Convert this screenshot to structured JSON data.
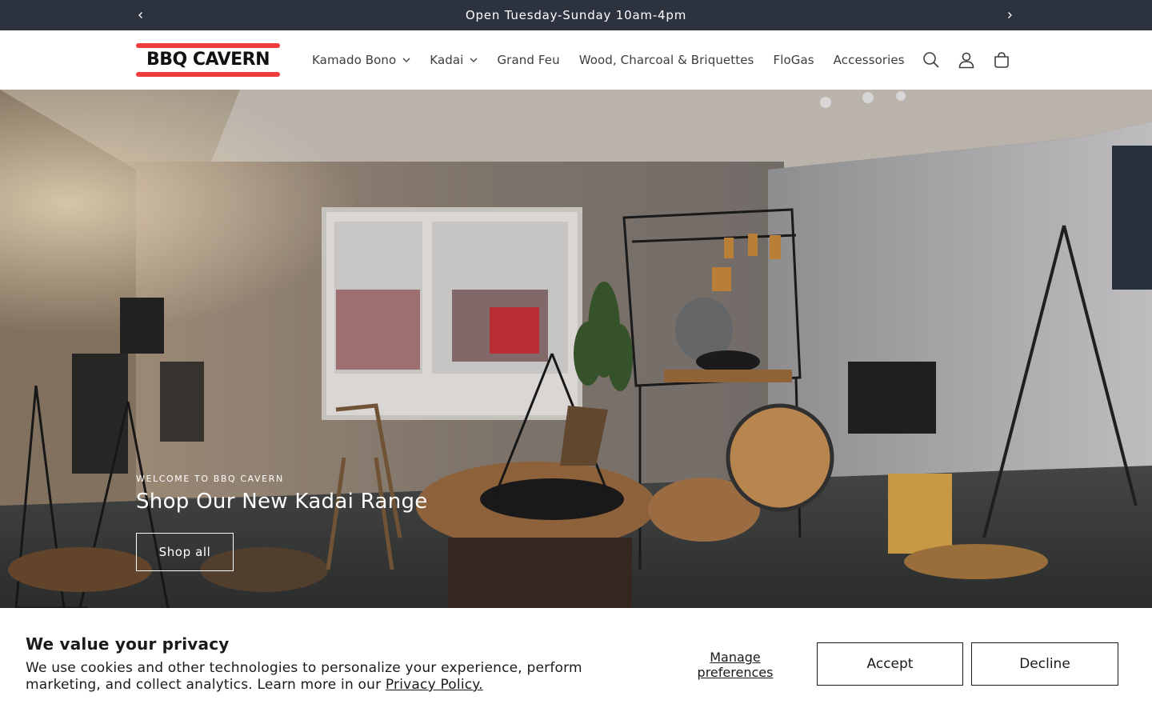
{
  "announcement": {
    "text": "Open Tuesday-Sunday 10am-4pm",
    "prev_icon": "chevron-left-icon",
    "next_icon": "chevron-right-icon"
  },
  "header": {
    "logo_text": "BBQ CAVERN",
    "nav": [
      {
        "label": "Kamado Bono",
        "has_dropdown": true
      },
      {
        "label": "Kadai",
        "has_dropdown": true
      },
      {
        "label": "Grand Feu",
        "has_dropdown": false
      },
      {
        "label": "Wood, Charcoal & Briquettes",
        "has_dropdown": false
      },
      {
        "label": "FloGas",
        "has_dropdown": false
      },
      {
        "label": "Accessories",
        "has_dropdown": false
      }
    ],
    "icons": [
      "search-icon",
      "account-icon",
      "cart-icon"
    ]
  },
  "hero": {
    "subtitle": "WELCOME TO BBQ CAVERN",
    "title": "Shop Our New Kadai Range",
    "button_label": "Shop all"
  },
  "cookie_banner": {
    "title": "We value your privacy",
    "text": "We use cookies and other technologies to personalize your experience, perform marketing, and collect analytics. Learn more in our ",
    "link_text": "Privacy Policy.",
    "manage_label": "Manage preferences",
    "accept_label": "Accept",
    "decline_label": "Decline"
  },
  "colors": {
    "announcement_bg": "#2c333f",
    "logo_red": "#ef3d3d",
    "text_dark": "#121212"
  }
}
